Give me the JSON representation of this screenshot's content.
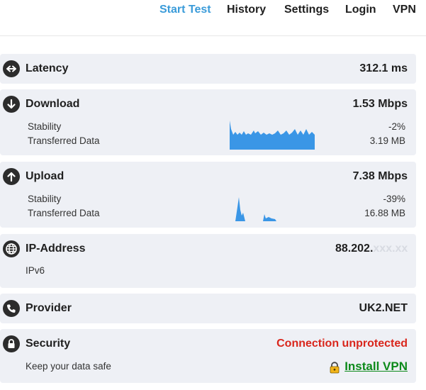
{
  "nav": {
    "items": [
      {
        "label": "Start Test",
        "active": true
      },
      {
        "label": "History",
        "active": false
      },
      {
        "label": "Settings",
        "active": false
      },
      {
        "label": "Login",
        "active": false
      },
      {
        "label": "VPN",
        "active": false
      }
    ]
  },
  "latency": {
    "title": "Latency",
    "value": "312.1 ms",
    "icon": "left-right-arrow-icon"
  },
  "download": {
    "title": "Download",
    "value": "1.53 Mbps",
    "icon": "arrow-down-icon",
    "stability_label": "Stability",
    "stability_value": "-2%",
    "transferred_label": "Transferred Data",
    "transferred_value": "3.19 MB",
    "chart_color": "#3a96e6"
  },
  "upload": {
    "title": "Upload",
    "value": "7.38 Mbps",
    "icon": "arrow-up-icon",
    "stability_label": "Stability",
    "stability_value": "-39%",
    "transferred_label": "Transferred Data",
    "transferred_value": "16.88 MB",
    "chart_color": "#3a96e6"
  },
  "ip": {
    "title": "IP-Address",
    "value_visible": "88.202.",
    "value_faded": "xxx.xx",
    "sub_label": "IPv6",
    "icon": "globe-icon"
  },
  "provider": {
    "title": "Provider",
    "value": "UK2.NET",
    "icon": "phone-icon"
  },
  "security": {
    "title": "Security",
    "status": "Connection unprotected",
    "status_color": "#d9261c",
    "sub_label": "Keep your data safe",
    "action_label": "Install VPN",
    "action_color": "#0d8a1b",
    "icon": "lock-icon"
  }
}
